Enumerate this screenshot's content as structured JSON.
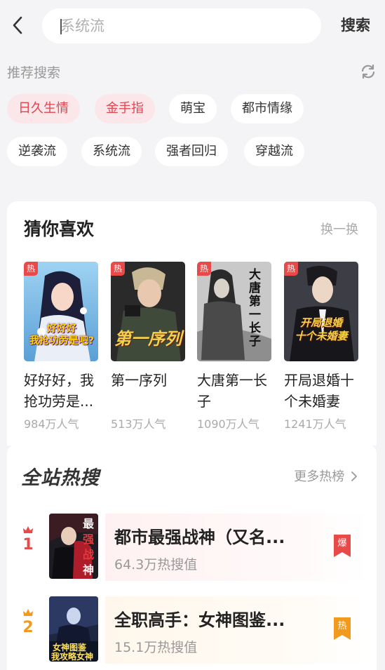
{
  "search": {
    "placeholder": "系统流",
    "button_label": "搜索"
  },
  "recommend": {
    "title": "推荐搜索",
    "tags": [
      "日久生情",
      "金手指",
      "萌宝",
      "都市情缘",
      "逆袭流",
      "系统流",
      "强者回归",
      "穿越流"
    ],
    "hot_tag_color": "#e0454f"
  },
  "guess": {
    "title": "猜你喜欢",
    "swap_label": "换一换",
    "badge": "热",
    "books": [
      {
        "title": "好好好，我抢功劳是...",
        "popularity": "984万人气",
        "cover_text": "好好好\n我抢功劳是吧?"
      },
      {
        "title": "第一序列",
        "popularity": "513万人气",
        "cover_text": "第一序列"
      },
      {
        "title": "大唐第一长子",
        "popularity": "1090万人气",
        "cover_text": "大唐第一长子"
      },
      {
        "title": "开局退婚十个未婚妻",
        "popularity": "1241万人气",
        "cover_text": "开局退婚\n十个未婚妻"
      }
    ]
  },
  "hot": {
    "title": "全站热搜",
    "more_label": "更多热榜",
    "items": [
      {
        "rank": "1",
        "title": "都市最强战神（又名...",
        "value": "64.3万热搜值",
        "flag": "爆",
        "color": "#e84a4a"
      },
      {
        "rank": "2",
        "title": "全职高手：女神图鉴...",
        "value": "15.1万热搜值",
        "flag": "热",
        "color": "#f29a1d"
      }
    ]
  }
}
